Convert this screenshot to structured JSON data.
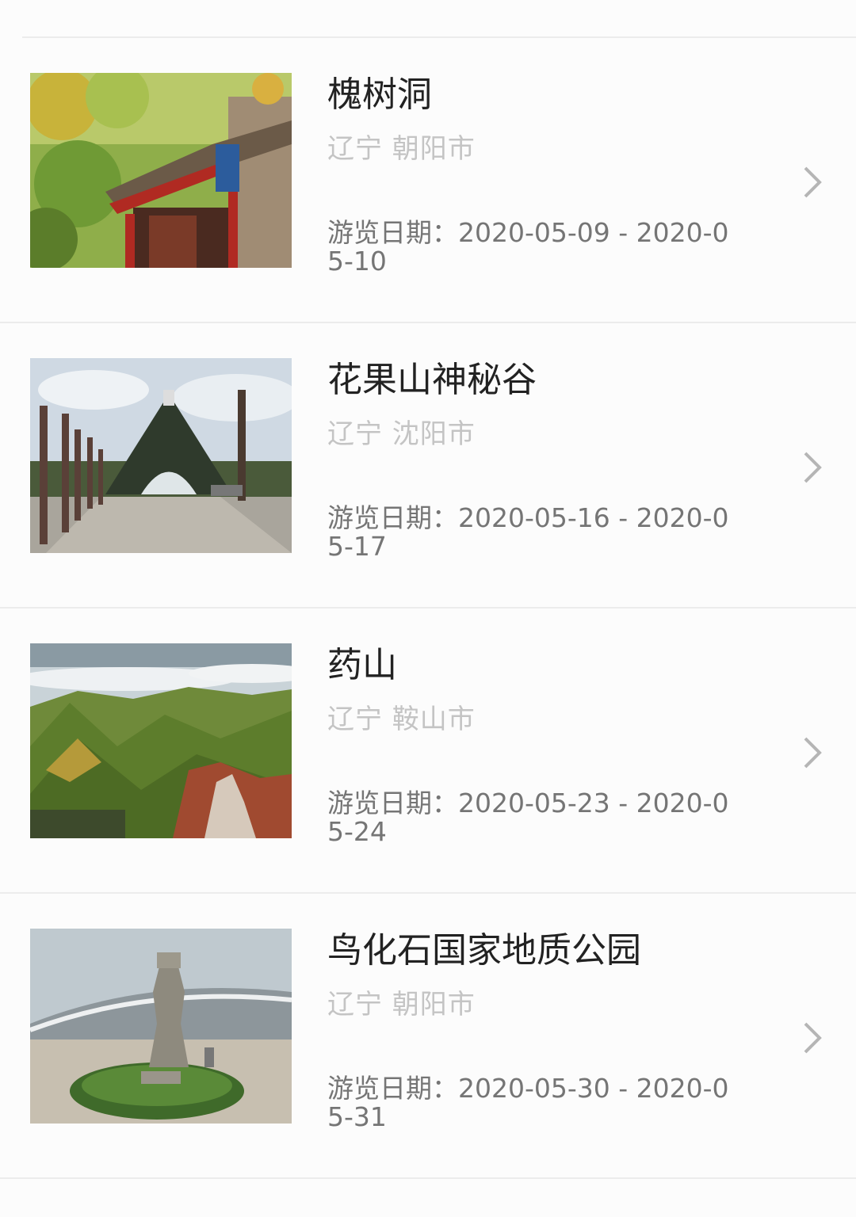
{
  "dates_label": "游览日期：",
  "items": [
    {
      "title": "槐树洞",
      "province": "辽宁",
      "city": "朝阳市",
      "location": "辽宁 朝阳市",
      "dates": "游览日期：2020-05-09 - 2020-05-10",
      "image": "temple-gate-with-autumn-trees"
    },
    {
      "title": "花果山神秘谷",
      "province": "辽宁",
      "city": "沈阳市",
      "location": "辽宁 沈阳市",
      "dates": "游览日期：2020-05-16 - 2020-05-17",
      "image": "triangular-gate-with-totem-poles"
    },
    {
      "title": "药山",
      "province": "辽宁",
      "city": "鞍山市",
      "location": "辽宁 鞍山市",
      "dates": "游览日期：2020-05-23 - 2020-05-24",
      "image": "green-mountain-ridges-with-clouds"
    },
    {
      "title": "鸟化石国家地质公园",
      "province": "辽宁",
      "city": "朝阳市",
      "location": "辽宁 朝阳市",
      "dates": "游览日期：2020-05-30 - 2020-05-31",
      "image": "stone-sculpture-before-museum"
    }
  ],
  "colors": {
    "title": "#222222",
    "location": "#c4c4c4",
    "dates": "#757575",
    "chevron": "#b5b5b5",
    "divider": "#ececec"
  }
}
